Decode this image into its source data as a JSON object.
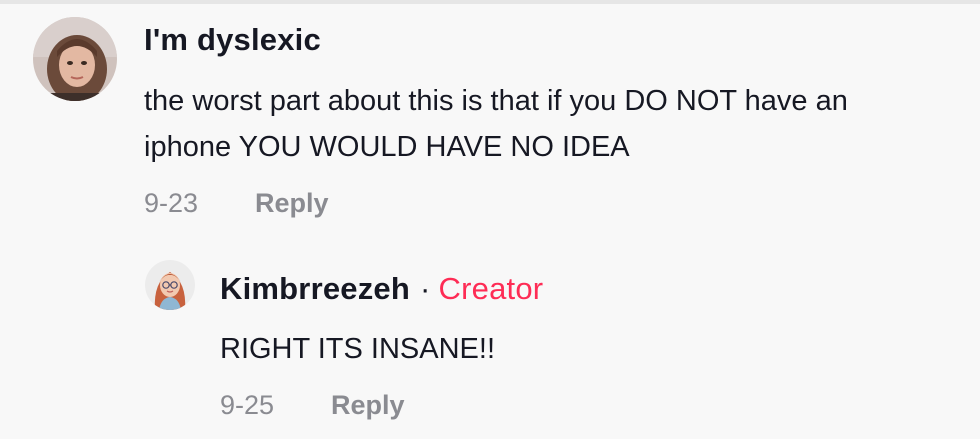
{
  "comments": [
    {
      "username": "I'm dyslexic",
      "avatar_icon": "user-avatar-photo",
      "text_lines": [
        "the worst part about this is that if you DO NOT have an",
        "iphone YOU WOULD HAVE NO IDEA"
      ],
      "date": "9-23",
      "reply_label": "Reply"
    }
  ],
  "replies": [
    {
      "username": "Kimbrreezeh",
      "separator": "·",
      "badge": "Creator",
      "avatar_icon": "cartoon-avatar",
      "text": "RIGHT ITS INSANE!!",
      "date": "9-25",
      "reply_label": "Reply"
    }
  ],
  "colors": {
    "background": "#f8f8f8",
    "primary_text": "#161823",
    "secondary_text": "#8a8b91",
    "creator_accent": "#fe2c55"
  }
}
